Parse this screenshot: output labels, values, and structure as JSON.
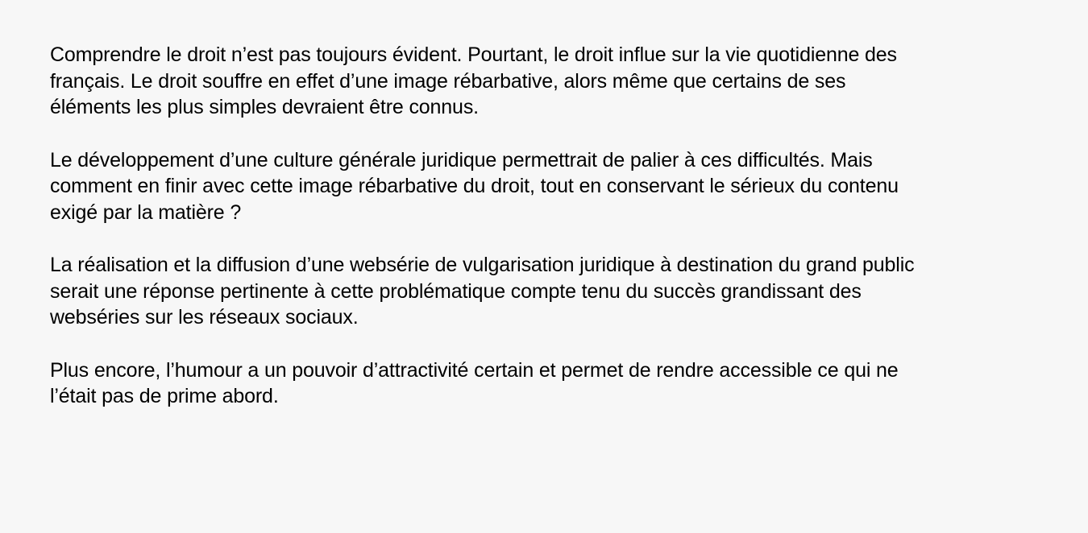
{
  "document": {
    "paragraphs": [
      {
        "lines": [
          "Comprendre le droit n’est pas toujours évident. Pourtant, le droit influe sur la vie quotidienne des",
          "français. Le droit souffre en effet d’une image rébarbative, alors même que certains de ses",
          "éléments les plus simples devraient être connus."
        ]
      },
      {
        "lines": [
          "Le développement d’une culture générale juridique permettrait de palier à ces difficultés. Mais",
          "comment en finir avec cette image rébarbative du droit, tout en conservant le sérieux du contenu",
          "exigé par la matière ?"
        ]
      },
      {
        "lines": [
          "La réalisation et la diffusion d’une websérie de vulgarisation juridique à destination du grand public",
          "serait une réponse pertinente à cette problématique compte tenu du succès grandissant des",
          "webséries sur les réseaux sociaux."
        ]
      },
      {
        "lines": [
          "Plus encore, l’humour a un pouvoir d’attractivité certain et permet de rendre accessible ce qui ne",
          "l’était pas de prime abord."
        ]
      }
    ]
  }
}
